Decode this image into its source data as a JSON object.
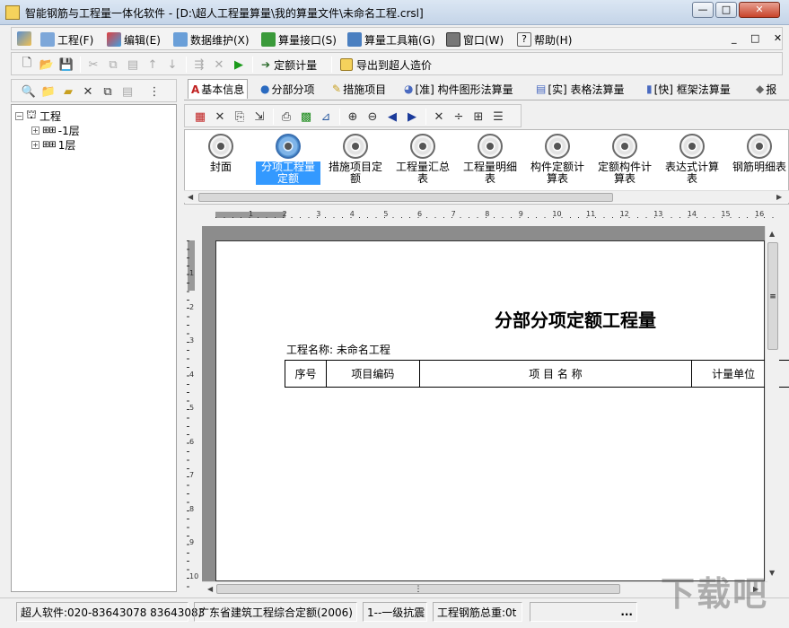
{
  "window": {
    "title": "智能钢筋与工程量一体化软件 - [D:\\超人工程量算量\\我的算量文件\\未命名工程.crsl]"
  },
  "menu": {
    "items": [
      "工程(F)",
      "编辑(E)",
      "数据维护(X)",
      "算量接口(S)",
      "算量工具箱(G)",
      "窗口(W)",
      "帮助(H)"
    ]
  },
  "toolbar": {
    "quota_calc": "定额计量",
    "export": "导出到超人造价"
  },
  "tree": {
    "root": "工程",
    "children": [
      "-1层",
      "1层"
    ]
  },
  "tabs": [
    "基本信息",
    "分部分项",
    "措施项目",
    "[准] 构件图形法算量",
    "[实] 表格法算量",
    "[快] 框架法算量",
    "报"
  ],
  "reports": [
    {
      "label": "封面"
    },
    {
      "label": "分项工程量定额"
    },
    {
      "label": "措施项目定额"
    },
    {
      "label": "工程量汇总表"
    },
    {
      "label": "工程量明细表"
    },
    {
      "label": "构件定额计算表"
    },
    {
      "label": "定额构件计算表"
    },
    {
      "label": "表达式计算表"
    },
    {
      "label": "钢筋明细表"
    }
  ],
  "ruler": {
    "h_ticks": [
      "1",
      "2",
      "3",
      "4",
      "5",
      "6",
      "7",
      "8",
      "9",
      "10",
      "11",
      "12",
      "13",
      "14",
      "15",
      "16"
    ],
    "v_ticks": [
      "1",
      "2",
      "3",
      "4",
      "5",
      "6",
      "7",
      "8",
      "9",
      "10"
    ]
  },
  "preview": {
    "title": "分部分项定额工程量",
    "project_label": "工程名称: 未命名工程",
    "columns": [
      "序号",
      "项目编码",
      "项 目 名 称",
      "计量单位"
    ]
  },
  "status": {
    "contact": "超人软件:020-83643078 83643083",
    "standard": "广东省建筑工程综合定额(2006)",
    "seismic": "1--一级抗震",
    "rebar_total": "工程钢筋总重:0t",
    "ellipsis": "..."
  },
  "watermark": "下载吧"
}
